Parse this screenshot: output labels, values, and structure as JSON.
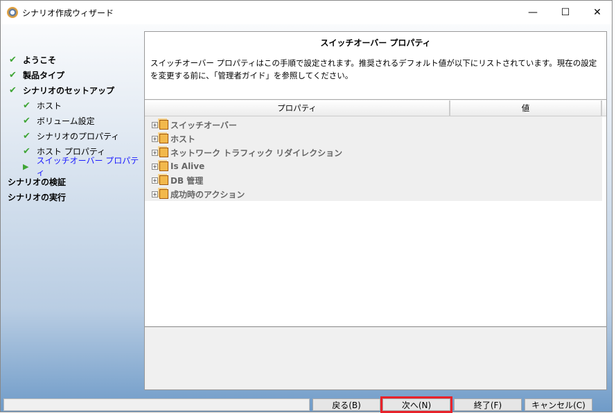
{
  "window": {
    "title": "シナリオ作成ウィザード",
    "minimize": "—",
    "maximize": "☐",
    "close": "✕"
  },
  "nav": [
    {
      "label": "ようこそ",
      "state": "done"
    },
    {
      "label": "製品タイプ",
      "state": "done"
    },
    {
      "label": "シナリオのセットアップ",
      "state": "done"
    },
    {
      "label": "ホスト",
      "state": "done"
    },
    {
      "label": "ボリューム設定",
      "state": "done"
    },
    {
      "label": "シナリオのプロパティ",
      "state": "done"
    },
    {
      "label": "ホスト プロパティ",
      "state": "done"
    },
    {
      "label": "スイッチオーバー プロパティ",
      "state": "current"
    },
    {
      "label": "シナリオの検証",
      "state": "pending"
    },
    {
      "label": "シナリオの実行",
      "state": "pending"
    }
  ],
  "header": {
    "title": "スイッチオーバー プロパティ",
    "description": "スイッチオーバー プロパティはこの手順で設定されます。推奨されるデフォルト値が以下にリストされています。現在の設定を変更する前に、「管理者ガイド」を参照してください。"
  },
  "grid": {
    "columns": [
      "プロパティ",
      "値"
    ],
    "rows": [
      "スイッチオーバー",
      "ホスト",
      "ネットワーク トラフィック リダイレクション",
      "Is Alive",
      "DB 管理",
      "成功時のアクション"
    ]
  },
  "buttons": {
    "back": "戻る(B)",
    "next": "次へ(N)",
    "finish": "終了(F)",
    "cancel": "キャンセル(C)"
  }
}
